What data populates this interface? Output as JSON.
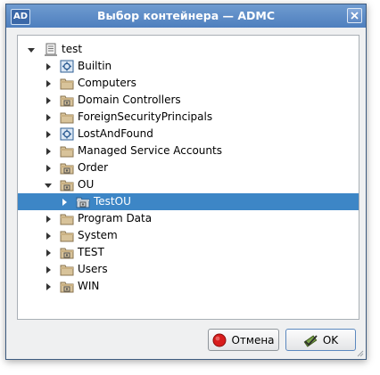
{
  "window": {
    "app_badge": "AD",
    "title": "Выбор контейнера — ADMC"
  },
  "tree": {
    "root": {
      "label": "test",
      "expanded": true
    },
    "items": [
      {
        "label": "Builtin",
        "icon": "builtin-container-icon",
        "expanded": false,
        "level": 1
      },
      {
        "label": "Computers",
        "icon": "folder-icon",
        "expanded": false,
        "level": 1
      },
      {
        "label": "Domain Controllers",
        "icon": "ou-folder-icon",
        "expanded": false,
        "level": 1
      },
      {
        "label": "ForeignSecurityPrincipals",
        "icon": "folder-icon",
        "expanded": false,
        "level": 1
      },
      {
        "label": "LostAndFound",
        "icon": "builtin-container-icon",
        "expanded": false,
        "level": 1
      },
      {
        "label": "Managed Service Accounts",
        "icon": "folder-icon",
        "expanded": false,
        "level": 1
      },
      {
        "label": "Order",
        "icon": "ou-folder-icon",
        "expanded": false,
        "level": 1
      },
      {
        "label": "OU",
        "icon": "ou-folder-icon",
        "expanded": true,
        "level": 1
      },
      {
        "label": "TestOU",
        "icon": "ou-folder-icon",
        "expanded": false,
        "level": 2,
        "selected": true
      },
      {
        "label": "Program Data",
        "icon": "folder-icon",
        "expanded": false,
        "level": 1
      },
      {
        "label": "System",
        "icon": "folder-icon",
        "expanded": false,
        "level": 1
      },
      {
        "label": "TEST",
        "icon": "ou-folder-icon",
        "expanded": false,
        "level": 1
      },
      {
        "label": "Users",
        "icon": "folder-icon",
        "expanded": false,
        "level": 1
      },
      {
        "label": "WIN",
        "icon": "ou-folder-icon",
        "expanded": false,
        "level": 1
      }
    ]
  },
  "buttons": {
    "cancel_label": "Отмена",
    "ok_label": "OK"
  },
  "colors": {
    "titlebar": "#5a88c6",
    "selection": "#3d86c6",
    "folder": "#d8c39a",
    "cancel_icon": "#d81c1c"
  }
}
